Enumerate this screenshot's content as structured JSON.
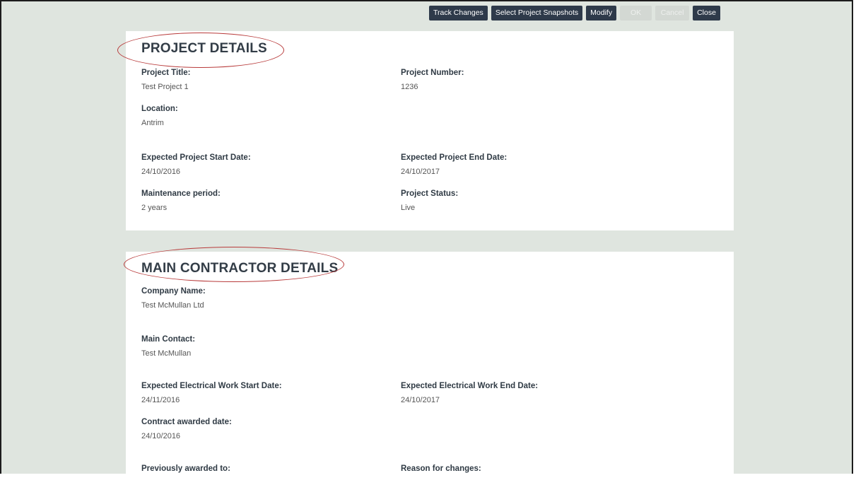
{
  "toolbar": {
    "track_changes": "Track Changes",
    "select_snapshots": "Select Project Snapshots",
    "modify": "Modify",
    "ok": "OK",
    "cancel": "Cancel",
    "close": "Close"
  },
  "project_details": {
    "heading": "PROJECT DETAILS",
    "project_title_label": "Project Title:",
    "project_title_value": "Test Project 1",
    "project_number_label": "Project Number:",
    "project_number_value": "1236",
    "location_label": "Location:",
    "location_value": "Antrim",
    "start_date_label": "Expected Project Start Date:",
    "start_date_value": "24/10/2016",
    "end_date_label": "Expected Project End Date:",
    "end_date_value": "24/10/2017",
    "maintenance_label": "Maintenance period:",
    "maintenance_value": "2 years",
    "status_label": "Project Status:",
    "status_value": "Live"
  },
  "main_contractor": {
    "heading": "MAIN CONTRACTOR DETAILS",
    "company_label": "Company Name:",
    "company_value": "Test McMullan Ltd",
    "contact_label": "Main Contact:",
    "contact_value": "Test McMullan",
    "elec_start_label": "Expected Electrical Work Start Date:",
    "elec_start_value": "24/11/2016",
    "elec_end_label": "Expected Electrical Work End Date:",
    "elec_end_value": "24/10/2017",
    "awarded_date_label": "Contract awarded date:",
    "awarded_date_value": "24/10/2016",
    "prev_awarded_label": "Previously awarded to:",
    "reason_label": "Reason for changes:"
  },
  "colors": {
    "button": "#2e3a4a",
    "annotation": "#b83a3a",
    "background": "#dfe5df"
  }
}
